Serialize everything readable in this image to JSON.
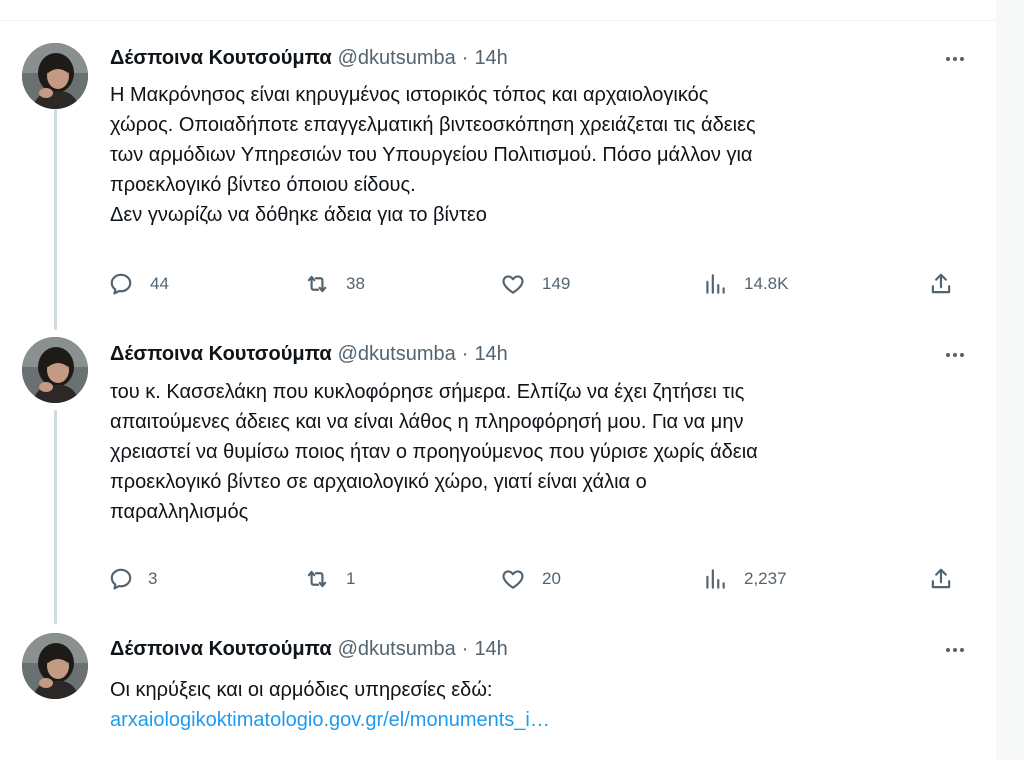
{
  "tweets": [
    {
      "author_name": "Δέσποινα Κουτσούμπα",
      "author_handle": "@dkutsumba",
      "separator": "·",
      "time": "14h",
      "text_lines": [
        "Η Μακρόνησος είναι κηρυγμένος ιστορικός τόπος και αρχαιολογικός",
        "χώρος. Οποιαδήποτε επαγγελματική βιντεοσκόπηση χρειάζεται τις άδειες",
        "των αρμόδιων Υπηρεσιών του Υπουργείου Πολιτισμού. Πόσο μάλλον για",
        "προεκλογικό βίντεο όποιου είδους.",
        "Δεν γνωρίζω να δόθηκε άδεια για το βίντεο"
      ],
      "replies": "44",
      "retweets": "38",
      "likes": "149",
      "views": "14.8K"
    },
    {
      "author_name": "Δέσποινα Κουτσούμπα",
      "author_handle": "@dkutsumba",
      "separator": "·",
      "time": "14h",
      "text_lines": [
        "του κ. Κασσελάκη που κυκλοφόρησε σήμερα. Ελπίζω να έχει ζητήσει τις",
        "απαιτούμενες άδειες και να είναι λάθος η πληροφόρησή μου. Για να μην",
        "χρειαστεί να θυμίσω ποιος ήταν ο προηγούμενος που γύρισε χωρίς άδεια",
        "προεκλογικό βίντεο σε αρχαιολογικό χώρο, γιατί είναι χάλια ο",
        "παραλληλισμός"
      ],
      "replies": "3",
      "retweets": "1",
      "likes": "20",
      "views": "2,237"
    },
    {
      "author_name": "Δέσποινα Κουτσούμπα",
      "author_handle": "@dkutsumba",
      "separator": "·",
      "time": "14h",
      "text_lines": [
        "Οι κηρύξεις και οι αρμόδιες υπηρεσίες εδώ:"
      ],
      "link_text": "arxaiologikoktimatologio.gov.gr/el/monuments_i…"
    }
  ],
  "icons": {
    "reply": "reply-icon",
    "retweet": "retweet-icon",
    "like": "heart-icon",
    "views": "views-chart-icon",
    "share": "share-icon",
    "more": "more-dots-icon"
  },
  "colors": {
    "text": "#0f1419",
    "secondary": "#536471",
    "link": "#1d9bf0",
    "thread_line": "#cfd9de",
    "divider": "#eff3f4"
  }
}
